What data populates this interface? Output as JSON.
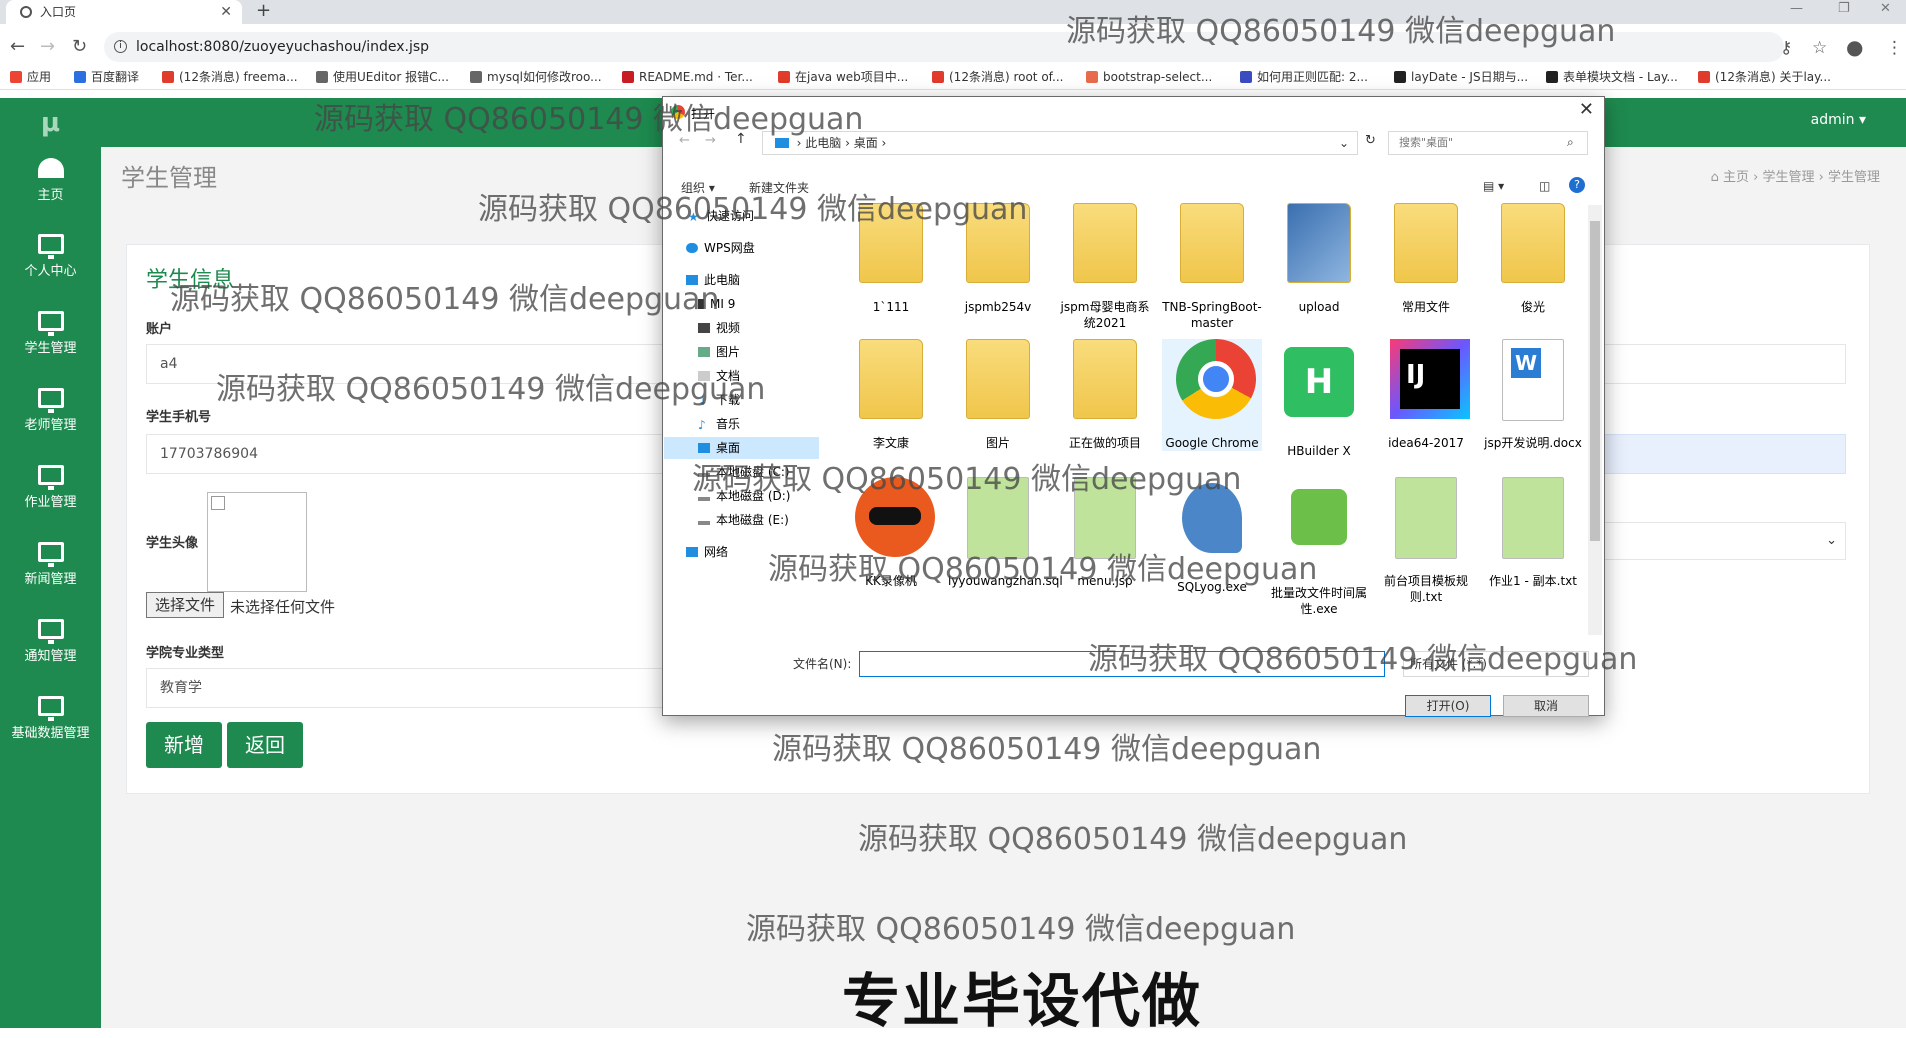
{
  "browser": {
    "tab_title": "入口页",
    "url": "localhost:8080/zuoyeyuchashou/index.jsp",
    "bookmarks": [
      "应用",
      "百度翻译",
      "(12条消息) freema...",
      "使用UEditor 报错C...",
      "mysql如何修改roo...",
      "README.md · Ter...",
      "在java web项目中...",
      "(12条消息) root of...",
      "bootstrap-select...",
      "如何用正则匹配: 2...",
      "layDate - JS日期与...",
      "表单模块文档 - Lay...",
      "(12条消息) 关于lay..."
    ]
  },
  "app": {
    "logo": "μ",
    "user": "admin",
    "sidebar": [
      "主页",
      "个人中心",
      "学生管理",
      "老师管理",
      "作业管理",
      "新闻管理",
      "通知管理",
      "基础数据管理"
    ],
    "page_title": "学生管理",
    "breadcrumb": [
      "主页",
      "学生管理",
      "学生管理"
    ],
    "section_title": "学生信息",
    "form": {
      "account_label": "账户",
      "account_value": "a4",
      "phone_label": "学生手机号",
      "phone_value": "17703786904",
      "avatar_label": "学生头像",
      "file_button": "选择文件",
      "file_status": "未选择任何文件",
      "major_label": "学院专业类型",
      "major_value": "教育学",
      "add_button": "新增",
      "back_button": "返回"
    }
  },
  "dialog": {
    "title": "打开",
    "path": [
      "此电脑",
      "桌面"
    ],
    "search_placeholder": "搜索\"桌面\"",
    "organize": "组织 ▾",
    "new_folder": "新建文件夹",
    "nav": [
      "快速访问",
      "WPS网盘",
      "此电脑",
      "MI 9",
      "视频",
      "图片",
      "文档",
      "下载",
      "音乐",
      "桌面",
      "本地磁盘 (C:)",
      "本地磁盘 (D:)",
      "本地磁盘 (E:)",
      "网络"
    ],
    "files": [
      "1`111",
      "jspmb254v",
      "jspm母婴电商系统2021",
      "TNB-SpringBoot-master",
      "upload",
      "常用文件",
      "俊光",
      "李文康",
      "图片",
      "正在做的项目",
      "Google Chrome",
      "HBuilder X",
      "idea64-2017",
      "jsp开发说明.docx",
      "KK录像机",
      "lyyouwangzhan.sql",
      "menu.jsp",
      "SQLyog.exe",
      "批量改文件时间属性.exe",
      "前台项目模板规则.txt",
      "作业1 - 副本.txt"
    ],
    "filename_label": "文件名(N):",
    "filetype": "所有文件 (*.*)",
    "open_button": "打开(O)",
    "cancel_button": "取消"
  },
  "watermark": "源码获取 QQ86050149 微信deepguan",
  "banner": "专业毕设代做",
  "colors": {
    "sidebar": "#1e8a4f",
    "accent": "#1e8a4f"
  }
}
